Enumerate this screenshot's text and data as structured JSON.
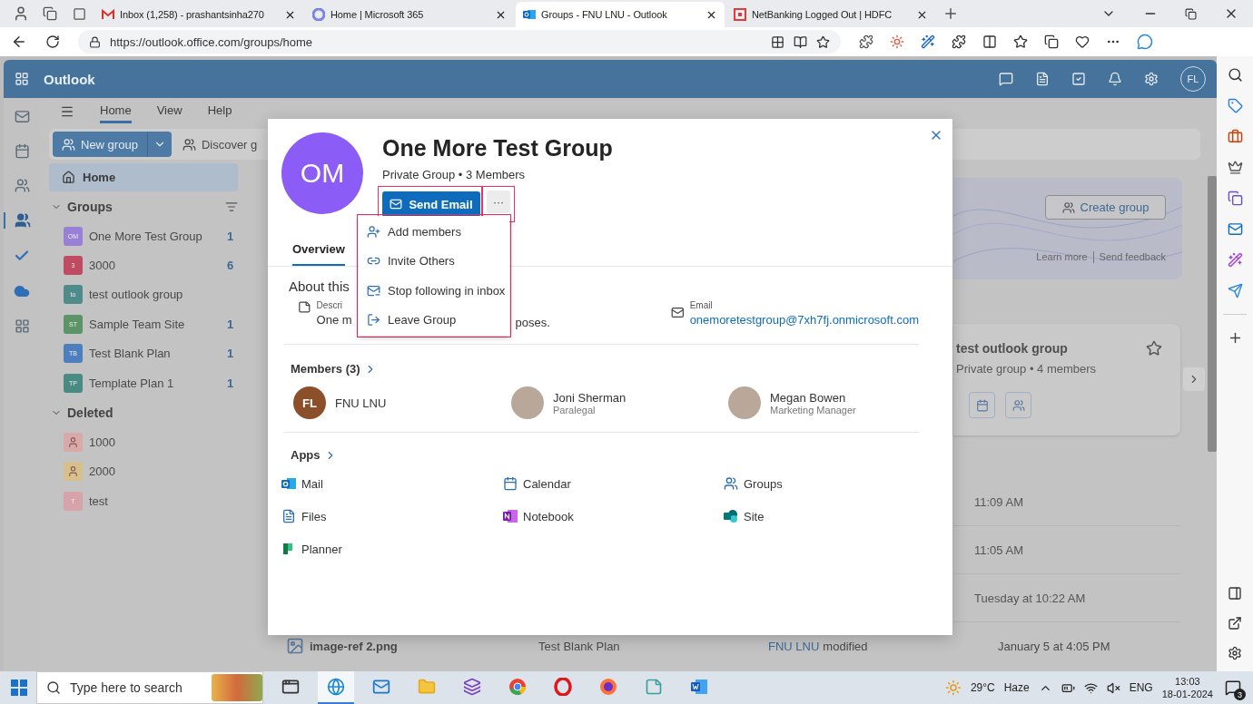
{
  "browser": {
    "tabs": [
      {
        "title": "Inbox (1,258) - prashantsinha270",
        "kind": "gmail",
        "selected": false
      },
      {
        "title": "Home | Microsoft 365",
        "kind": "m365",
        "selected": false
      },
      {
        "title": "Groups - FNU LNU - Outlook",
        "kind": "outlook",
        "selected": true
      },
      {
        "title": "NetBanking Logged Out | HDFC",
        "kind": "bank",
        "selected": false
      }
    ],
    "address": "https://outlook.office.com/groups/home"
  },
  "app": {
    "title": "Outlook",
    "user_initials": "FL"
  },
  "ribbon": {
    "tabs": [
      {
        "label": "Home",
        "selected": true
      },
      {
        "label": "View",
        "selected": false
      },
      {
        "label": "Help",
        "selected": false
      }
    ],
    "new_group": "New group",
    "discover": "Discover g"
  },
  "nav": {
    "home": {
      "label": "Home",
      "selected": true
    },
    "sections": [
      {
        "title": "Groups",
        "expanded": true,
        "items": [
          {
            "label": "One More Test Group",
            "kind": "initials",
            "initials": "OM",
            "color": "#9a7fd6",
            "count": "1"
          },
          {
            "label": "3000",
            "kind": "initials",
            "initials": "3",
            "color": "#c04a62",
            "count": "6"
          },
          {
            "label": "test outlook group",
            "kind": "initials",
            "initials": "to",
            "color": "#4f8b8a"
          },
          {
            "label": "Sample Team Site",
            "kind": "initials",
            "initials": "ST",
            "color": "#5b9467",
            "count": "1"
          },
          {
            "label": "Test Blank Plan",
            "kind": "initials",
            "initials": "TB",
            "color": "#4d7fbe",
            "count": "1"
          },
          {
            "label": "Template Plan 1",
            "kind": "initials",
            "initials": "TP",
            "color": "#4a8a84",
            "count": "1"
          }
        ]
      },
      {
        "title": "Deleted",
        "expanded": true,
        "items": [
          {
            "label": "1000",
            "kind": "person",
            "color": "#d9a9a9"
          },
          {
            "label": "2000",
            "kind": "person",
            "color": "#d6c08c"
          },
          {
            "label": "test",
            "kind": "initials",
            "initials": "T",
            "color": "#d6a3a8"
          }
        ]
      }
    ]
  },
  "main": {
    "banner": {
      "create_group": "Create group",
      "links": [
        "Learn more",
        "Send feedback"
      ]
    },
    "suggested_card": {
      "title": "test outlook group",
      "subtitle": "Private group • 4 members",
      "starred": false
    },
    "recent_times": [
      "11:09 AM",
      "11:05 AM",
      "Tuesday at 10:22 AM"
    ],
    "file_row": {
      "name": "image-ref 2.png",
      "group": "Test Blank Plan",
      "actor": "FNU LNU",
      "action": "modified",
      "time": "January 5 at 4:05 PM"
    }
  },
  "group_dialog": {
    "avatar_initials": "OM",
    "title": "One More Test Group",
    "subtitle": "Private Group • 3 Members",
    "send_email": "Send Email",
    "more": "···",
    "menu": [
      {
        "label": "Add members",
        "kind": "add"
      },
      {
        "label": "Invite Others",
        "kind": "link"
      },
      {
        "label": "Stop following in inbox",
        "kind": "unfollow"
      },
      {
        "label": "Leave Group",
        "kind": "leave"
      }
    ],
    "tabs": [
      {
        "label": "Overview",
        "selected": true
      }
    ],
    "about": {
      "heading": "About this",
      "description_label": "Descri",
      "description_start": "One m",
      "description_end": "poses.",
      "email_label": "Email",
      "email": "onemoretestgroup@7xh7fj.onmicrosoft.com"
    },
    "members": {
      "heading": "Members (3)",
      "items": [
        {
          "name": "FNU LNU",
          "kind": "initials",
          "initials": "FL"
        },
        {
          "name": "Joni Sherman",
          "role": "Paralegal",
          "kind": "photo"
        },
        {
          "name": "Megan Bowen",
          "role": "Marketing Manager",
          "kind": "photo"
        }
      ]
    },
    "apps": {
      "heading": "Apps",
      "items": [
        {
          "label": "Mail",
          "kind": "mail"
        },
        {
          "label": "Calendar",
          "kind": "calendar"
        },
        {
          "label": "Groups",
          "kind": "groups"
        },
        {
          "label": "Files",
          "kind": "files"
        },
        {
          "label": "Notebook",
          "kind": "notebook"
        },
        {
          "label": "Site",
          "kind": "site"
        },
        {
          "label": "Planner",
          "kind": "planner"
        }
      ]
    }
  },
  "taskbar": {
    "search_placeholder": "Type here to search",
    "apps": [
      {
        "kind": "taskview",
        "selected": false
      },
      {
        "kind": "edge",
        "selected": true
      },
      {
        "kind": "mail",
        "selected": false
      },
      {
        "kind": "explorer",
        "selected": false
      },
      {
        "kind": "studio",
        "selected": false
      },
      {
        "kind": "chrome",
        "selected": false
      },
      {
        "kind": "opera",
        "selected": false
      },
      {
        "kind": "firefox",
        "selected": false
      },
      {
        "kind": "notes",
        "selected": false
      },
      {
        "kind": "word",
        "selected": false
      }
    ],
    "weather": {
      "temp": "29°C",
      "condition": "Haze"
    },
    "language": "ENG",
    "time": "13:03",
    "date": "18-01-2024",
    "notifications": "3"
  }
}
